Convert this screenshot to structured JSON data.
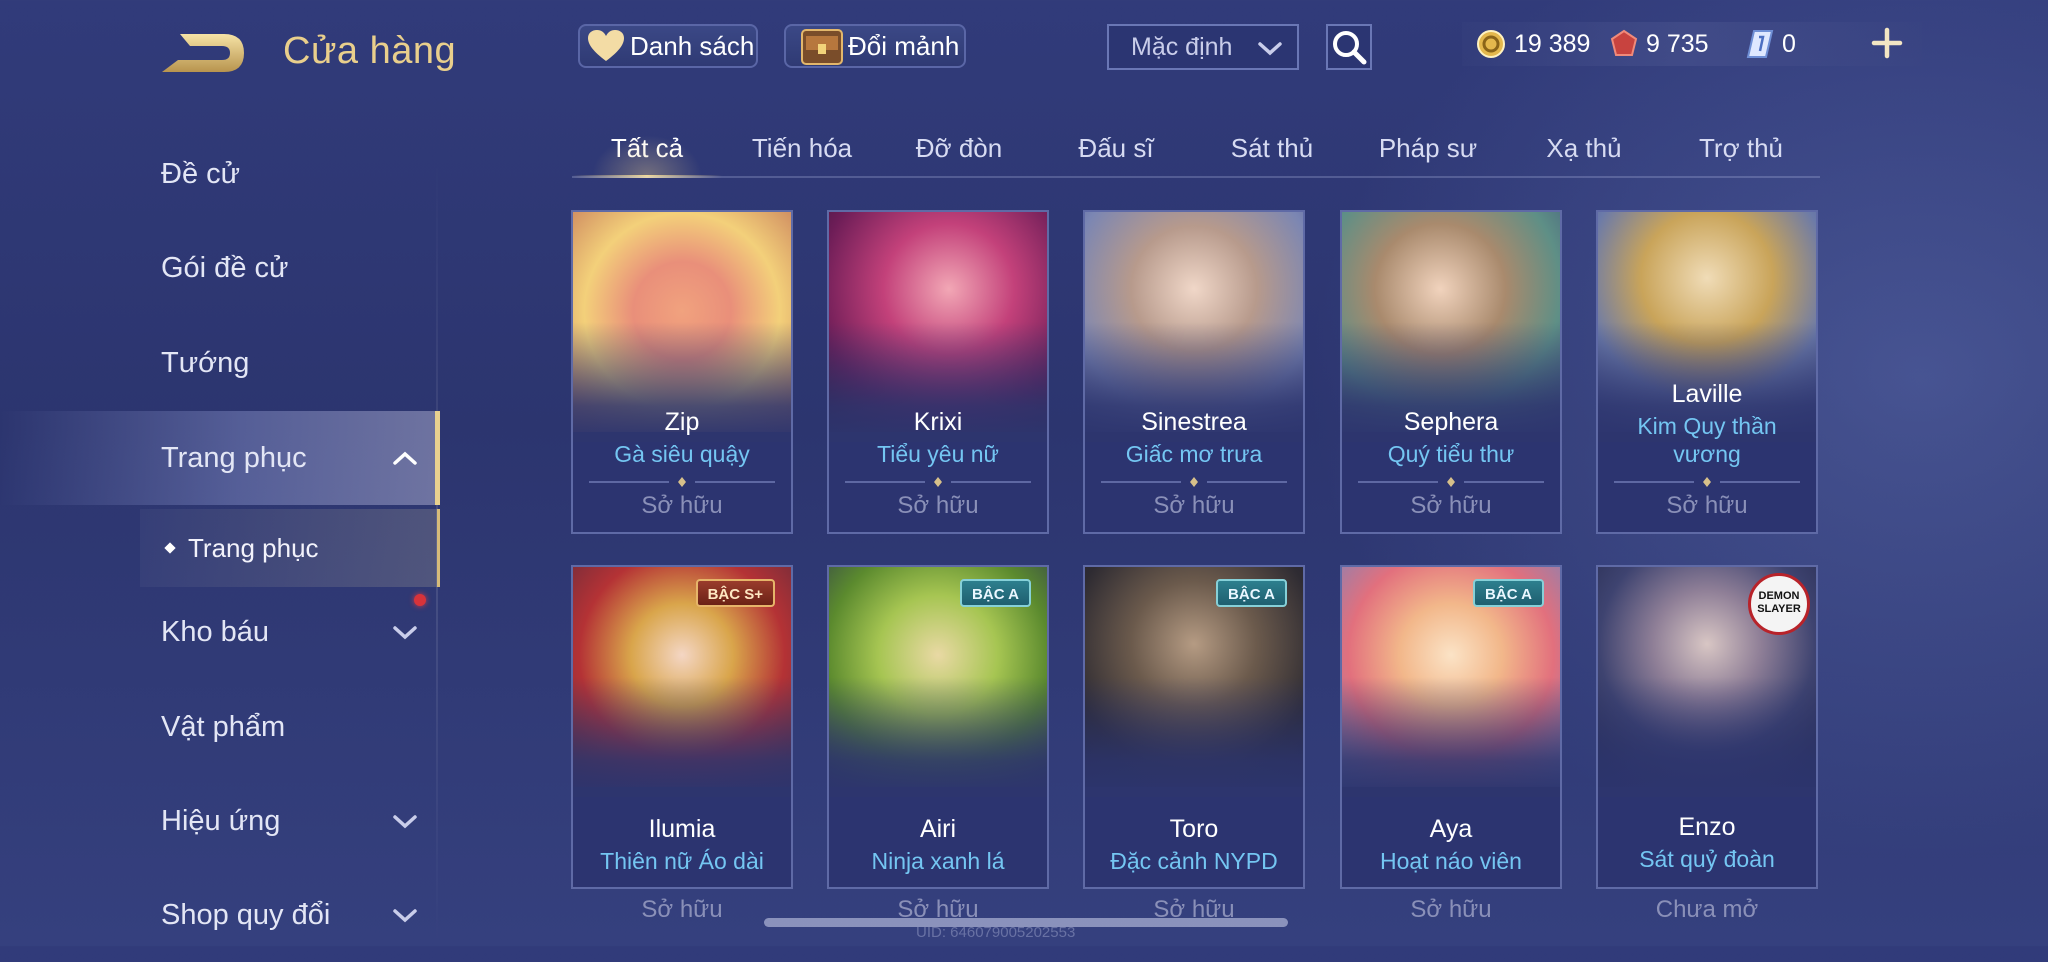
{
  "header": {
    "title": "Cửa hàng"
  },
  "sidebar": {
    "items": [
      {
        "label": "Đề cử"
      },
      {
        "label": "Gói đề cử"
      },
      {
        "label": "Tướng"
      },
      {
        "label": "Trang phục"
      },
      {
        "label": "Kho báu"
      },
      {
        "label": "Vật phẩm"
      },
      {
        "label": "Hiệu ứng"
      },
      {
        "label": "Shop quy đổi"
      }
    ],
    "sub_item": {
      "label": "Trang phục"
    }
  },
  "toolbar": {
    "wishlist_label": "Danh sách",
    "exchange_label": "Đổi mảnh",
    "sort_value": "Mặc định"
  },
  "currency": {
    "gold": "19 389",
    "vouchers": "9 735",
    "tickets": "0"
  },
  "tabs": [
    {
      "label": "Tất cả"
    },
    {
      "label": "Tiến hóa"
    },
    {
      "label": "Đỡ đòn"
    },
    {
      "label": "Đấu sĩ"
    },
    {
      "label": "Sát thủ"
    },
    {
      "label": "Pháp sư"
    },
    {
      "label": "Xạ thủ"
    },
    {
      "label": "Trợ thủ"
    }
  ],
  "cards": [
    {
      "hero": "Zip",
      "skin": "Gà siêu quậy",
      "status": "Sở hữu"
    },
    {
      "hero": "Krixi",
      "skin": "Tiểu yêu nữ",
      "status": "Sở hữu"
    },
    {
      "hero": "Sinestrea",
      "skin": "Giấc mơ trưa",
      "status": "Sở hữu"
    },
    {
      "hero": "Sephera",
      "skin": "Quý tiểu thư",
      "status": "Sở hữu"
    },
    {
      "hero": "Laville",
      "skin": "Kim Quy thần vương",
      "status": "Sở hữu"
    },
    {
      "hero": "Ilumia",
      "skin": "Thiên nữ Áo dài",
      "status": "Sở hữu",
      "badge": "BẬC S+"
    },
    {
      "hero": "Airi",
      "skin": "Ninja xanh lá",
      "status": "Sở hữu",
      "badge": "BẬC A"
    },
    {
      "hero": "Toro",
      "skin": "Đặc cảnh NYPD",
      "status": "Sở hữu",
      "badge": "BẬC A"
    },
    {
      "hero": "Aya",
      "skin": "Hoạt náo viên",
      "status": "Sở hữu",
      "badge": "BẬC A"
    },
    {
      "hero": "Enzo",
      "skin": "Sát quỷ đoàn",
      "status": "Chưa mở",
      "badge": "DEMON SLAYER"
    }
  ],
  "footer": {
    "uid": "UID: 646079005202553"
  },
  "colors": {
    "accent_gold": "#e9cf8c",
    "skin_name_blue": "#74c6f2",
    "background": "#313b7a"
  }
}
